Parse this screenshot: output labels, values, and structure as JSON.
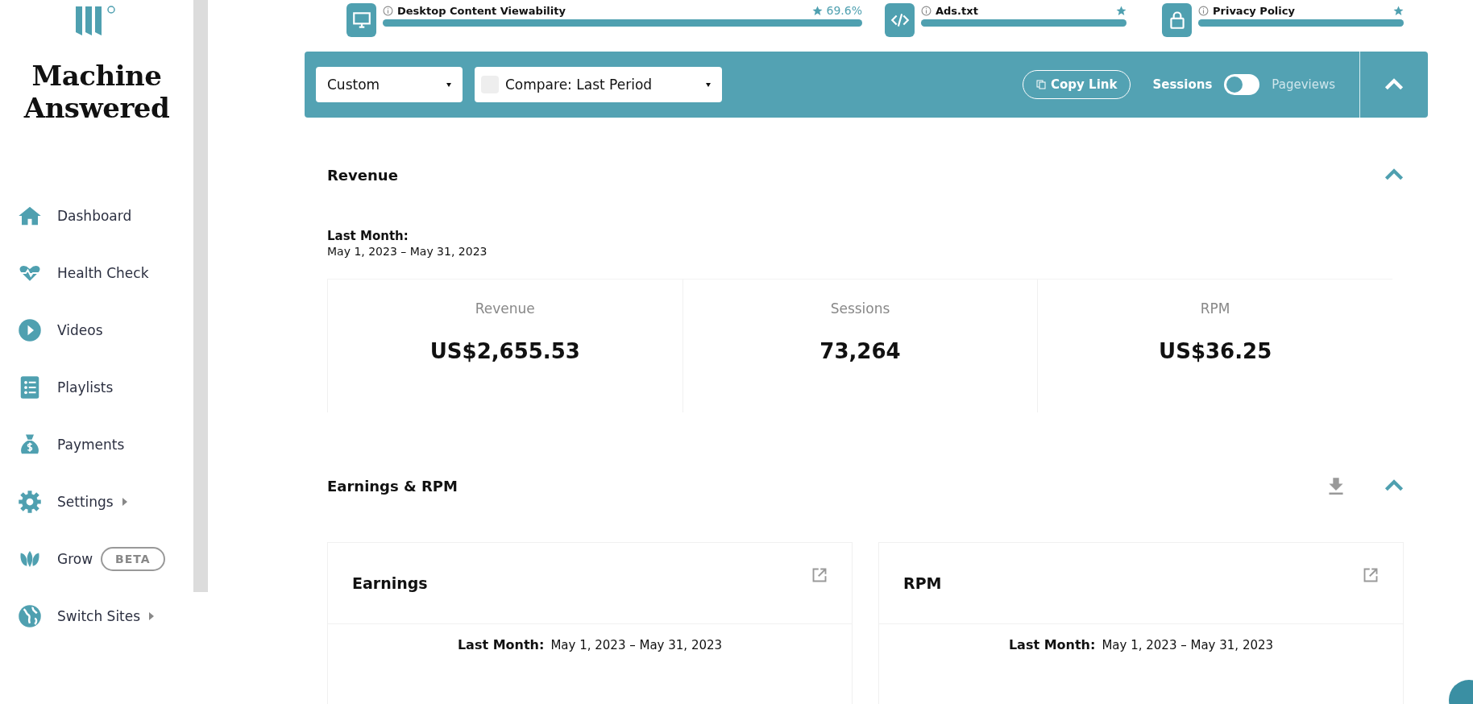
{
  "sidebar": {
    "brand": "Machine Answered",
    "items": [
      {
        "label": "Dashboard",
        "submenu": false
      },
      {
        "label": "Health Check",
        "submenu": false
      },
      {
        "label": "Videos",
        "submenu": false
      },
      {
        "label": "Playlists",
        "submenu": false
      },
      {
        "label": "Payments",
        "submenu": false
      },
      {
        "label": "Settings",
        "submenu": true
      },
      {
        "label": "Grow",
        "submenu": false,
        "badge": "BETA"
      },
      {
        "label": "Switch Sites",
        "submenu": true
      }
    ]
  },
  "health_checks": [
    {
      "label": "Desktop Content Viewability",
      "reading": "69.6%",
      "level": 1
    },
    {
      "label": "Ads.txt",
      "level": 1
    },
    {
      "label": "Privacy Policy",
      "level": 1
    }
  ],
  "filter_bar": {
    "date_range": "Custom",
    "compare": {
      "label": "Compare: Last Period",
      "checked": false
    },
    "copy_link": "Copy Link",
    "toggle": {
      "left": "Sessions",
      "right": "Pageviews",
      "on": false
    }
  },
  "revenue": {
    "title": "Revenue",
    "period_label": "Last Month:",
    "period": "May 1, 2023 – May 31, 2023",
    "metrics": [
      {
        "label": "Revenue",
        "value": "US$2,655.53"
      },
      {
        "label": "Sessions",
        "value": "73,264"
      },
      {
        "label": "RPM",
        "value": "US$36.25"
      }
    ]
  },
  "earnings_rpm": {
    "title": "Earnings & RPM",
    "cards": [
      {
        "title": "Earnings",
        "period_label": "Last Month:",
        "period": "May 1, 2023 – May 31, 2023"
      },
      {
        "title": "RPM",
        "period_label": "Last Month:",
        "period": "May 1, 2023 – May 31, 2023"
      }
    ]
  }
}
